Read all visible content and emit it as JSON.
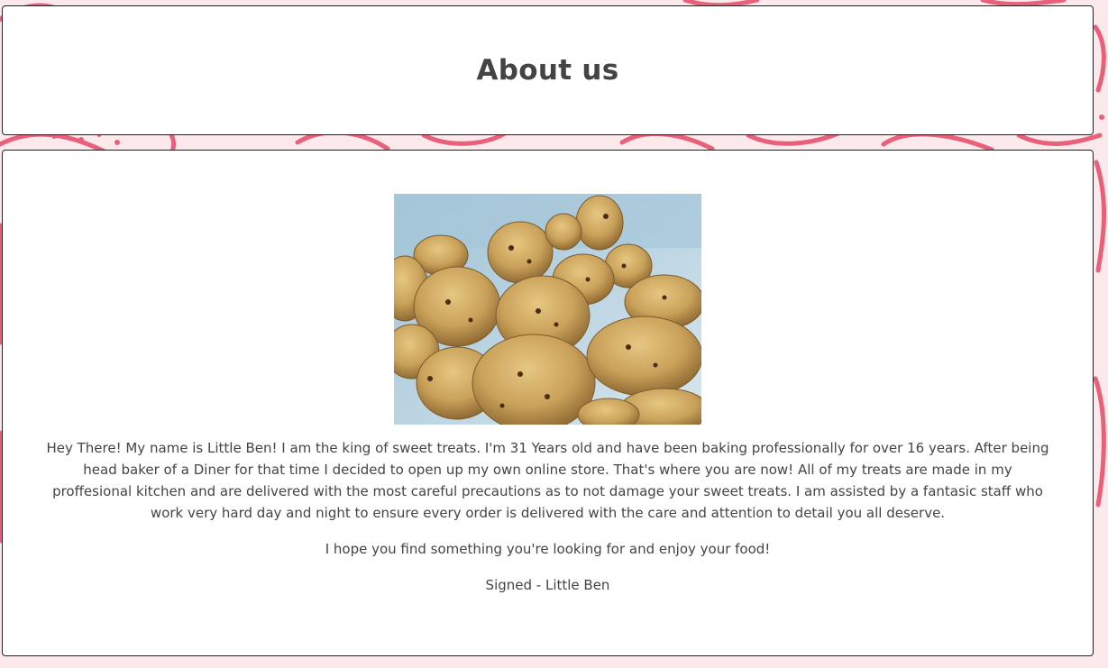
{
  "header": {
    "title": "About us"
  },
  "about": {
    "photo_icon": "scones-photo",
    "intro": "Hey There! My name is Little Ben! I am the king of sweet treats. I'm 31 Years old and have been baking professionally for over 16 years. After being head baker of a Diner for that time I decided to open up my own online store. That's where you are now! All of my treats are made in my proffesional kitchen and are delivered with the most careful precautions as to not damage your sweet treats. I am assisted by a fantasic staff who work very hard day and night to ensure every order is delivered with the care and attention to detail you all deserve.",
    "hope": "I hope you find something you're looking for and enjoy your food!",
    "signature": "Signed - Little Ben"
  },
  "colors": {
    "doodle": "#e8607a",
    "text": "#444444",
    "card": "#ffffff"
  }
}
